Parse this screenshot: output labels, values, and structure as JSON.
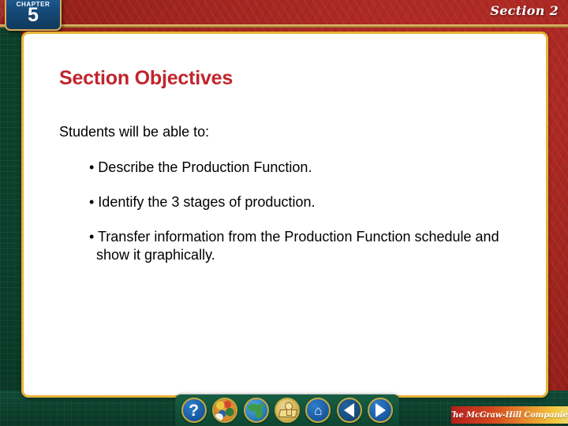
{
  "slide": {
    "chapter": {
      "word": "CHAPTER",
      "number": "5"
    },
    "section_label": "Section 2",
    "title": "Section Objectives",
    "lead": "Students will be able to:",
    "bullets": [
      "• Describe the Production Function.",
      "• Identify the 3 stages of production.",
      "• Transfer information from the Production Function schedule and show it graphically."
    ]
  },
  "nav": {
    "buttons": [
      {
        "name": "help-icon",
        "label": "?"
      },
      {
        "name": "palette-icon",
        "label": ""
      },
      {
        "name": "globe-icon",
        "label": ""
      },
      {
        "name": "podium-icon",
        "label": ""
      },
      {
        "name": "home-icon",
        "label": "⌂"
      },
      {
        "name": "previous-icon",
        "label": ""
      },
      {
        "name": "next-icon",
        "label": ""
      }
    ]
  },
  "footer": {
    "publisher": "The McGraw-Hill Companies"
  },
  "colors": {
    "red_bg": "#ab2720",
    "green_frame": "#0c4430",
    "gold_border": "#e8b338",
    "title_red": "#c0252b",
    "tab_blue": "#164b79",
    "body_text": "#000000"
  }
}
